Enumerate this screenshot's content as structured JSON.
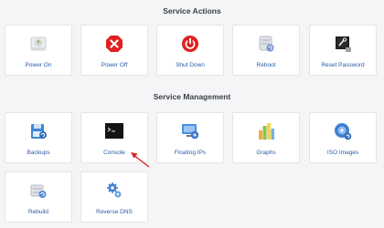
{
  "service_actions": {
    "title": "Service Actions",
    "items": [
      {
        "label": "Power On",
        "icon": "power-on-icon"
      },
      {
        "label": "Power Off",
        "icon": "power-off-icon"
      },
      {
        "label": "Shut Down",
        "icon": "shut-down-icon"
      },
      {
        "label": "Reboot",
        "icon": "reboot-icon"
      },
      {
        "label": "Reset Password",
        "icon": "reset-password-icon"
      }
    ]
  },
  "service_management": {
    "title": "Service Management",
    "items": [
      {
        "label": "Backups",
        "icon": "backups-icon"
      },
      {
        "label": "Console",
        "icon": "console-icon"
      },
      {
        "label": "Floating IPs",
        "icon": "floating-ips-icon"
      },
      {
        "label": "Graphs",
        "icon": "graphs-icon"
      },
      {
        "label": "ISO Images",
        "icon": "iso-images-icon"
      },
      {
        "label": "Rebuild",
        "icon": "rebuild-icon"
      },
      {
        "label": "Reverse DNS",
        "icon": "reverse-dns-icon"
      }
    ]
  },
  "colors": {
    "link": "#2a5ba8",
    "danger": "#e02020",
    "annotation_arrow": "#e0201e"
  }
}
